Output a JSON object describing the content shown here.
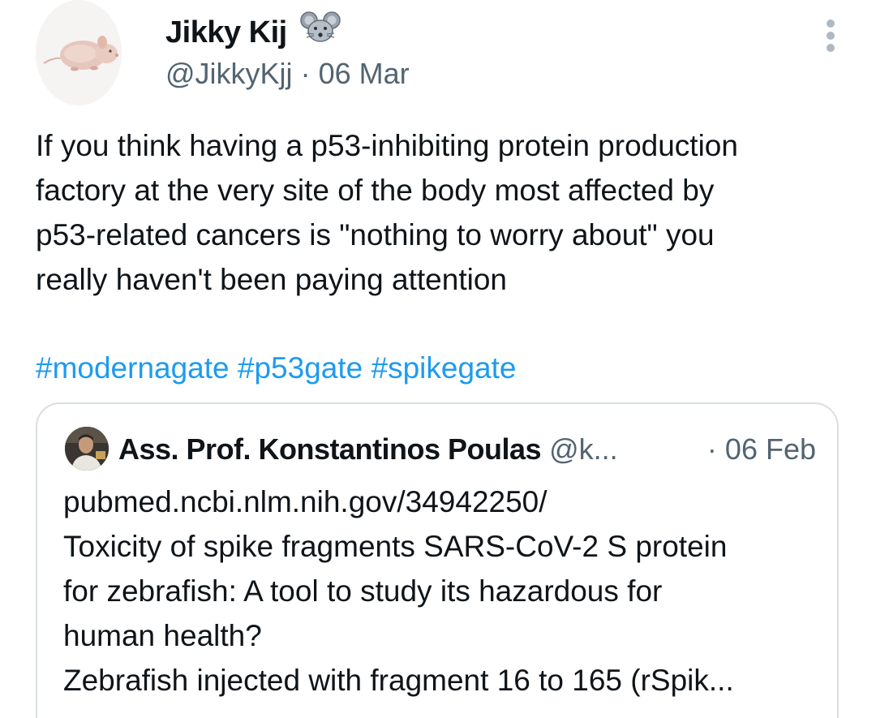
{
  "tweet": {
    "display_name": "Jikky Kij",
    "name_emoji": "mouse-face-emoji",
    "handle": "@JikkyKjj",
    "separator": " · ",
    "date": "06 Mar",
    "text": "If you think having a p53-inhibiting protein production\nfactory at the very site of the body most affected by\np53-related cancers is \"nothing to worry about\" you\nreally haven't been paying attention",
    "hashtags": [
      "#modernagate",
      "#p53gate",
      "#spikegate"
    ]
  },
  "quoted_tweet": {
    "display_name": "Ass. Prof. Konstantinos Poulas",
    "handle": "@k...",
    "separator": "·",
    "date": "06 Feb",
    "text": "pubmed.ncbi.nlm.nih.gov/34942250/\nToxicity of spike fragments SARS-CoV-2 S protein\nfor zebrafish: A tool to study its hazardous for\nhuman health?\nZebrafish injected with fragment 16 to 165 (rSpik..."
  },
  "icons": {
    "more": "more-vertical-icon",
    "avatar": "hairless-mouse-avatar",
    "quote_avatar": "person-avatar"
  },
  "colors": {
    "text": "#0f1419",
    "secondary": "#536471",
    "link": "#1d9bf0",
    "border": "#d9dee2"
  }
}
